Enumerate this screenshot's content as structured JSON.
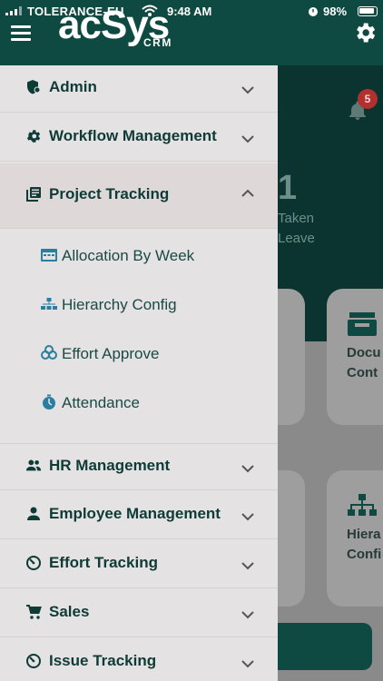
{
  "status_bar": {
    "carrier": "TOLERANCE-EU",
    "time": "9:48 AM",
    "battery": "98%"
  },
  "header": {
    "logo": "acSys",
    "logo_sub": "CRM"
  },
  "background": {
    "notification_count": "5",
    "stat_number": "1",
    "stat_label_1": "Taken",
    "stat_label_2": "Leave",
    "card_docs_1": "Docu",
    "card_docs_2": "Cont",
    "card_hier_1": "Hiera",
    "card_hier_2": "Confi"
  },
  "menu": {
    "admin": "Admin",
    "workflow": "Workflow Management",
    "project_tracking": "Project Tracking",
    "sub": {
      "allocation": "Allocation By Week",
      "hierarchy": "Hierarchy Config",
      "effort_approve": "Effort Approve",
      "attendance": "Attendance"
    },
    "hr": "HR Management",
    "employee": "Employee Management",
    "effort_tracking": "Effort Tracking",
    "sales": "Sales",
    "issue_tracking": "Issue Tracking"
  },
  "colors": {
    "brand": "#0f4a42",
    "drawer_bg": "#e4e2e2",
    "text": "#0f3b36",
    "accent_sub": "#2a7fa0",
    "badge": "#b2302e"
  }
}
